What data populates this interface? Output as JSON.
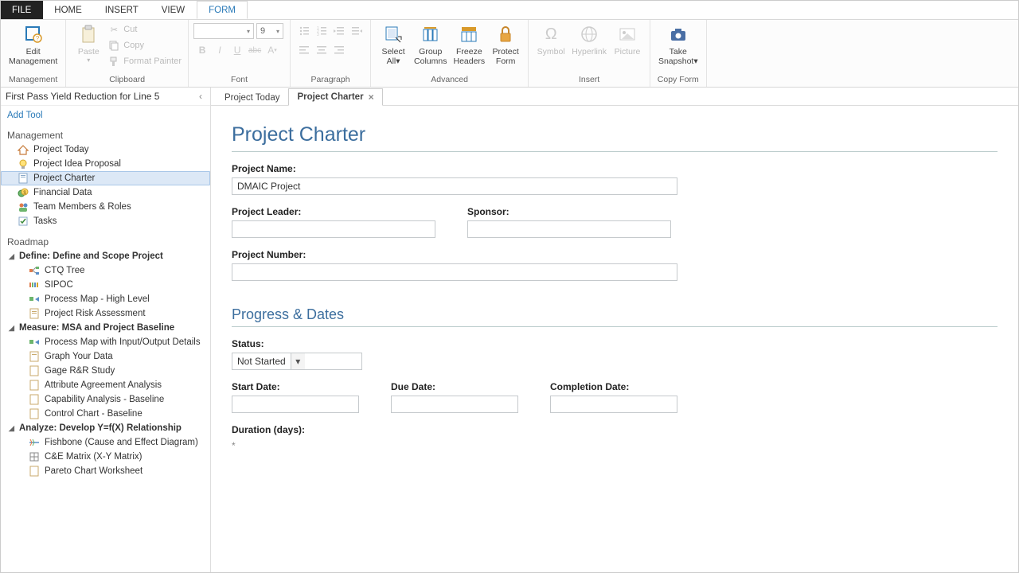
{
  "menu": {
    "file": "FILE",
    "home": "HOME",
    "insert": "INSERT",
    "view": "VIEW",
    "form": "FORM"
  },
  "ribbon": {
    "management": {
      "edit": "Edit",
      "management": "Management",
      "group": "Management"
    },
    "clipboard": {
      "paste": "Paste",
      "cut": "Cut",
      "copy": "Copy",
      "fp": "Format Painter",
      "group": "Clipboard"
    },
    "font": {
      "size": "9",
      "bold": "B",
      "italic": "I",
      "underline": "U",
      "strike": "abc",
      "fontA": "A",
      "group": "Font"
    },
    "paragraph": {
      "group": "Paragraph"
    },
    "advanced": {
      "selectall": "Select\nAll",
      "groupcols": "Group\nColumns",
      "freeze": "Freeze\nHeaders",
      "protect": "Protect\nForm",
      "group": "Advanced"
    },
    "insert": {
      "symbol": "Symbol",
      "hyperlink": "Hyperlink",
      "picture": "Picture",
      "group": "Insert"
    },
    "copyform": {
      "snapshot": "Take\nSnapshot",
      "group": "Copy Form"
    }
  },
  "project_title": "First Pass Yield Reduction for Line 5",
  "add_tool": "Add Tool",
  "sections": {
    "management": "Management",
    "roadmap": "Roadmap"
  },
  "mgmt_items": [
    {
      "label": "Project Today"
    },
    {
      "label": "Project Idea Proposal"
    },
    {
      "label": "Project Charter"
    },
    {
      "label": "Financial Data"
    },
    {
      "label": "Team Members & Roles"
    },
    {
      "label": "Tasks"
    }
  ],
  "phases": [
    {
      "label": "Define:  Define and Scope Project",
      "items": [
        "CTQ Tree",
        "SIPOC",
        "Process Map - High Level",
        "Project Risk Assessment"
      ]
    },
    {
      "label": "Measure:  MSA and Project Baseline",
      "items": [
        "Process Map with Input/Output Details",
        "Graph Your Data",
        "Gage R&R Study",
        "Attribute Agreement Analysis",
        "Capability Analysis - Baseline",
        "Control Chart - Baseline"
      ]
    },
    {
      "label": "Analyze:  Develop Y=f(X) Relationship",
      "items": [
        "Fishbone (Cause and Effect Diagram)",
        "C&E Matrix (X-Y Matrix)",
        "Pareto Chart Worksheet"
      ]
    }
  ],
  "doctabs": {
    "t1": "Project Today",
    "t2": "Project Charter"
  },
  "form": {
    "title": "Project Charter",
    "project_name_label": "Project Name:",
    "project_name": "DMAIC Project",
    "leader_label": "Project Leader:",
    "sponsor_label": "Sponsor:",
    "number_label": "Project Number:",
    "progress_title": "Progress & Dates",
    "status_label": "Status:",
    "status_value": "Not Started",
    "start_label": "Start Date:",
    "due_label": "Due Date:",
    "completion_label": "Completion Date:",
    "duration_label": "Duration (days):",
    "asterisk": "*"
  }
}
